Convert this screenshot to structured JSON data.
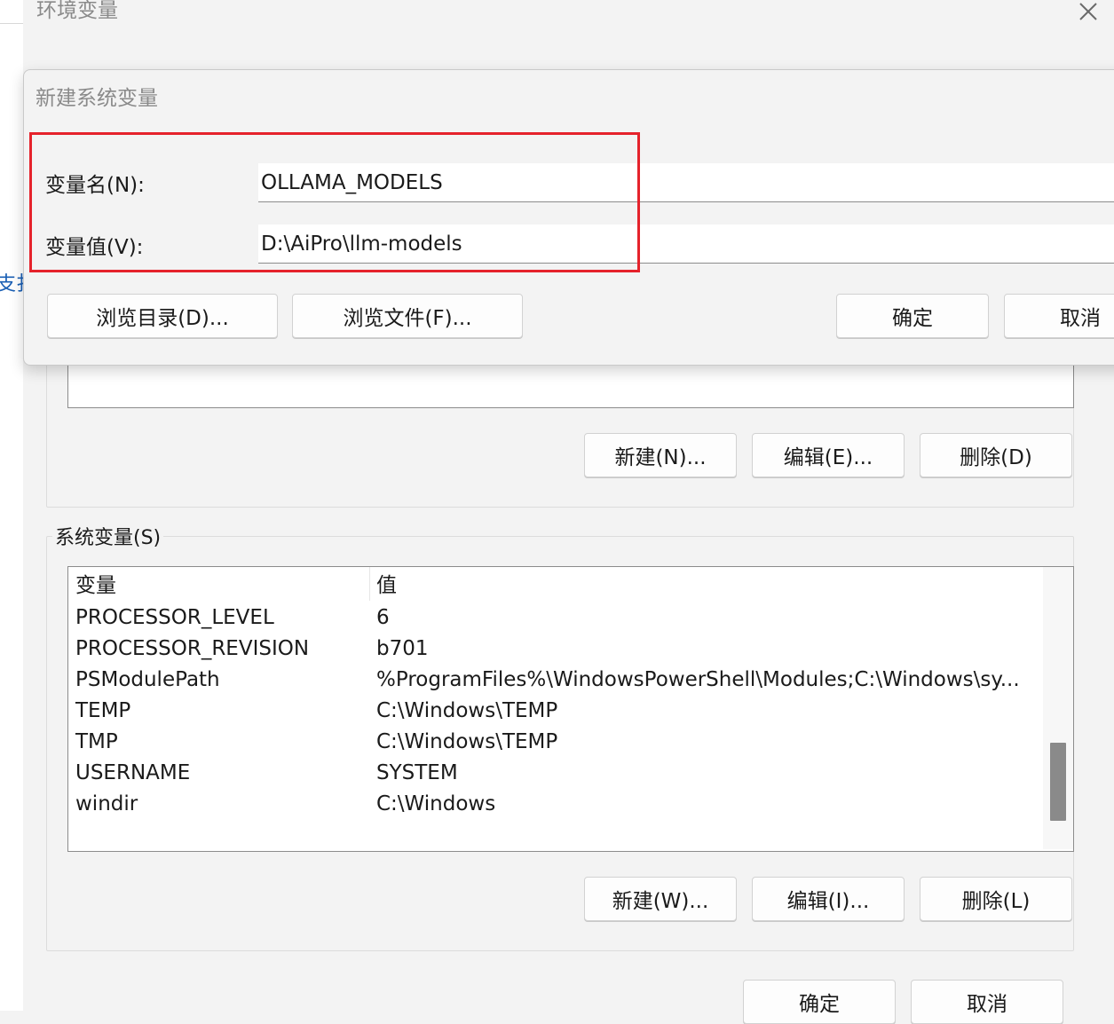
{
  "sidebar": {
    "partial_link": "支扌"
  },
  "env_window": {
    "title": "环境变量",
    "user_buttons": {
      "new": "新建(N)...",
      "edit": "编辑(E)...",
      "delete": "删除(D)"
    },
    "system_group": {
      "label": "系统变量(S)",
      "columns": [
        "变量",
        "值"
      ],
      "rows": [
        {
          "name": "PROCESSOR_LEVEL",
          "value": "6"
        },
        {
          "name": "PROCESSOR_REVISION",
          "value": "b701"
        },
        {
          "name": "PSModulePath",
          "value": "%ProgramFiles%\\WindowsPowerShell\\Modules;C:\\Windows\\sy..."
        },
        {
          "name": "TEMP",
          "value": "C:\\Windows\\TEMP"
        },
        {
          "name": "TMP",
          "value": "C:\\Windows\\TEMP"
        },
        {
          "name": "USERNAME",
          "value": "SYSTEM"
        },
        {
          "name": "windir",
          "value": "C:\\Windows"
        }
      ],
      "buttons": {
        "new": "新建(W)...",
        "edit": "编辑(I)...",
        "delete": "删除(L)"
      }
    },
    "footer": {
      "ok": "确定",
      "cancel": "取消"
    }
  },
  "dialog": {
    "title": "新建系统变量",
    "name_label": "变量名(N):",
    "name_value": "OLLAMA_MODELS",
    "value_label": "变量值(V):",
    "value_value": "D:\\AiPro\\llm-models",
    "browse_dir": "浏览目录(D)...",
    "browse_file": "浏览文件(F)...",
    "ok": "确定",
    "cancel": "取消"
  },
  "colors": {
    "highlight": "#e5222b",
    "link": "#1a5fb4"
  }
}
